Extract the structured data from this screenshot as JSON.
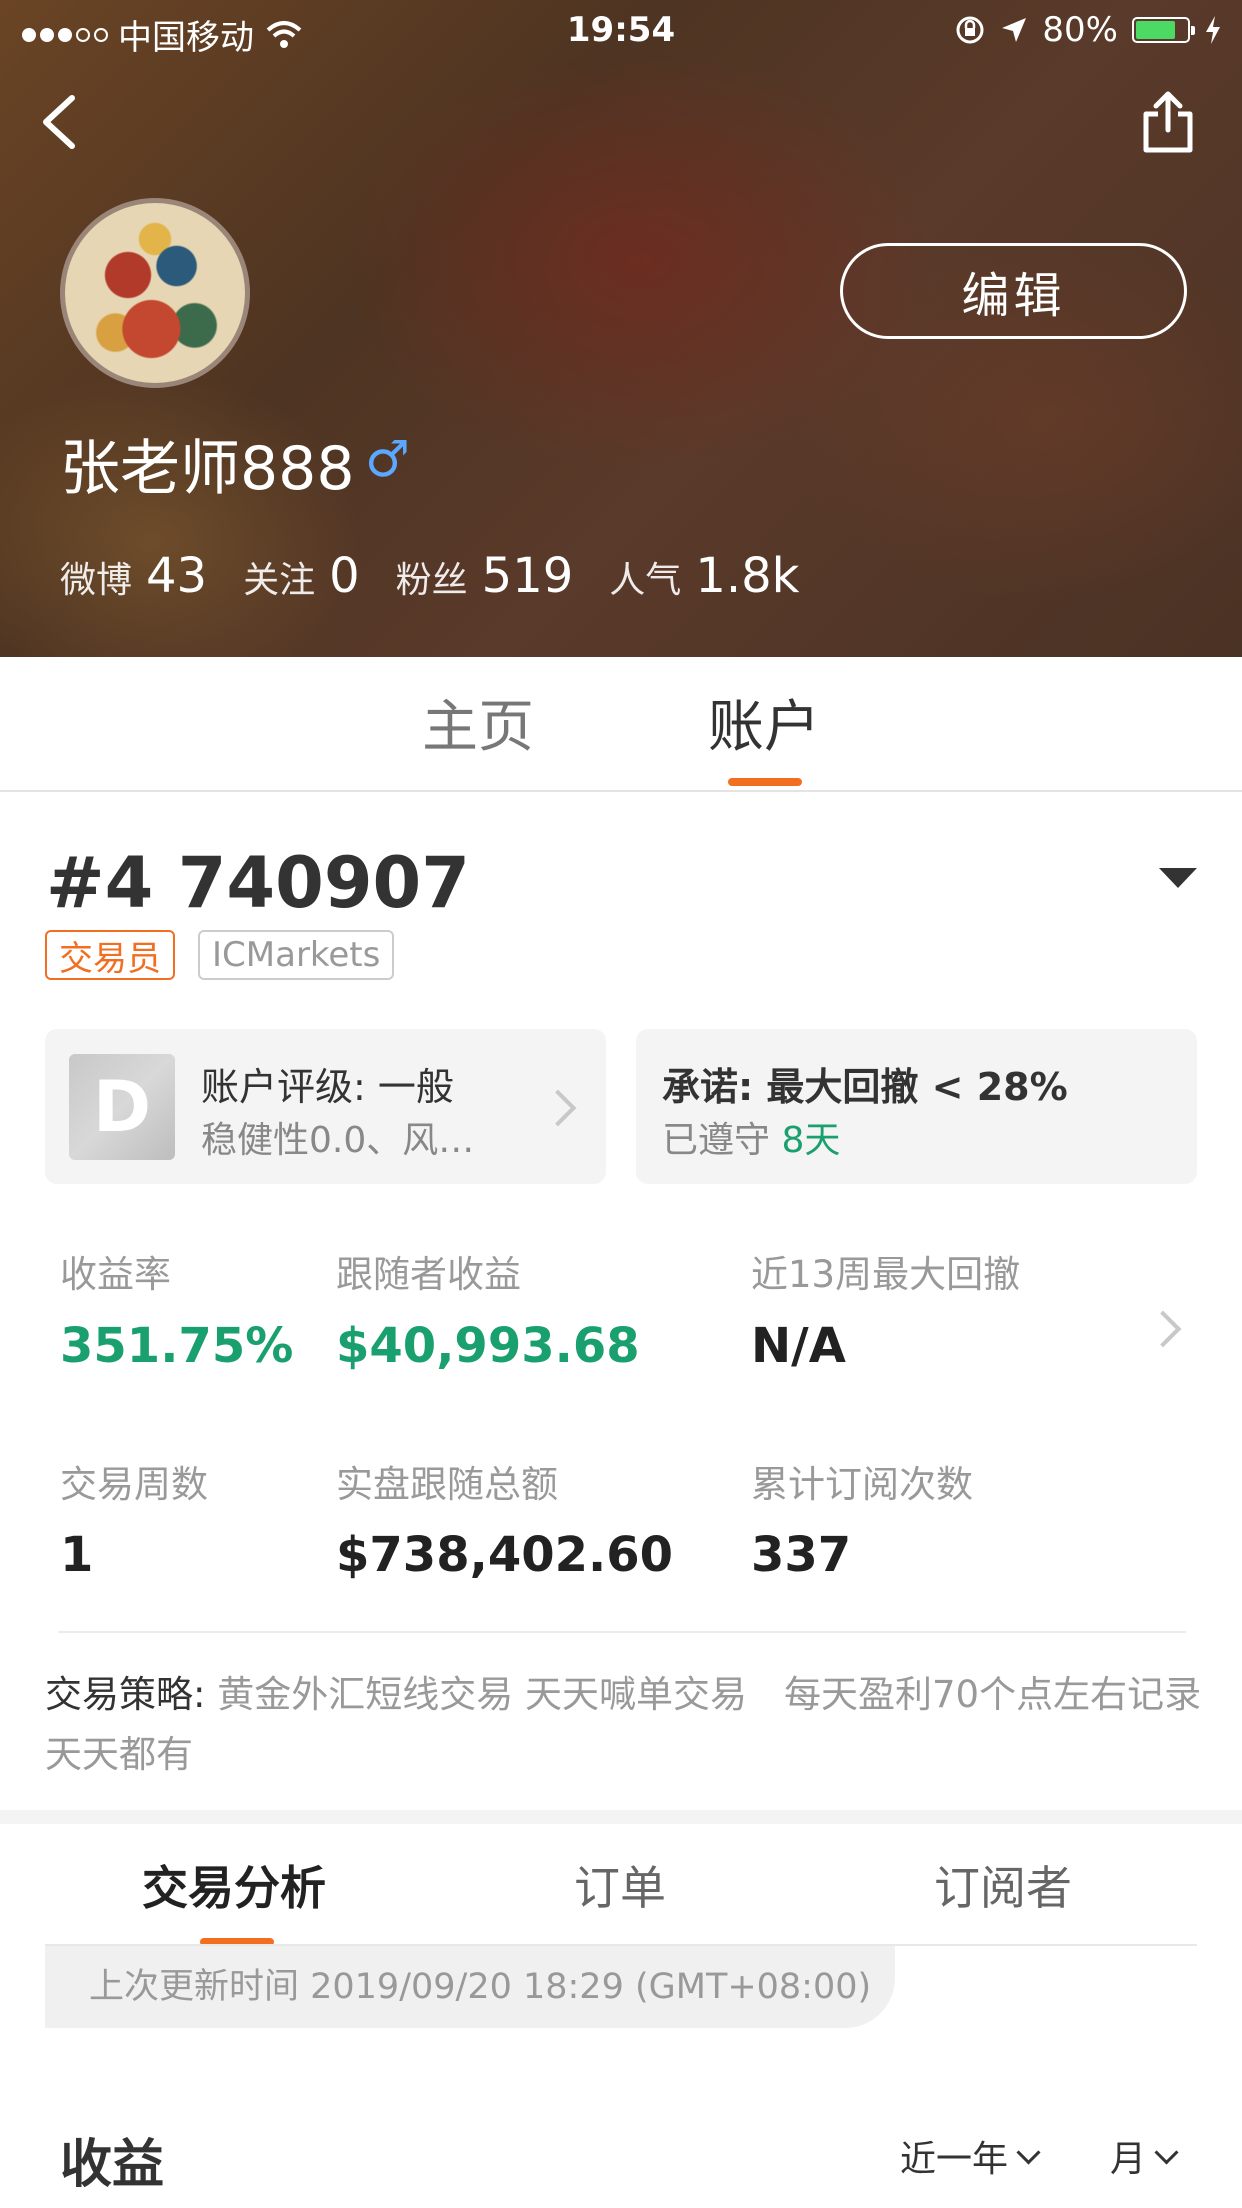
{
  "status_bar": {
    "carrier": "中国移动",
    "time": "19:54",
    "battery": "80%",
    "battery_level": 0.8
  },
  "profile": {
    "edit_label": "编辑",
    "name": "张老师888",
    "gender_symbol": "♂",
    "stats": [
      {
        "label": "微博",
        "value": "43"
      },
      {
        "label": "关注",
        "value": "0"
      },
      {
        "label": "粉丝",
        "value": "519"
      },
      {
        "label": "人气",
        "value": "1.8k"
      }
    ]
  },
  "tabs": [
    "主页",
    "账户"
  ],
  "account": {
    "id": "#4 740907",
    "role_tag": "交易员",
    "broker_tag": "ICMarkets",
    "rating": {
      "grade": "D",
      "title": "账户评级: 一般",
      "subtitle": "稳健性0.0、风…"
    },
    "promise": {
      "title": "承诺: 最大回撤 < 28%",
      "kept_label": "已遵守",
      "kept_value": "8天"
    },
    "metrics": [
      {
        "label": "收益率",
        "value": "351.75%"
      },
      {
        "label": "跟随者收益",
        "value": "$40,993.68"
      },
      {
        "label": "近13周最大回撤",
        "value": "N/A"
      },
      {
        "label": "交易周数",
        "value": "1"
      },
      {
        "label": "实盘跟随总额",
        "value": "$738,402.60"
      },
      {
        "label": "累计订阅次数",
        "value": "337"
      }
    ],
    "strategy_label": "交易策略:",
    "strategy_text": "黄金外汇短线交易 天天喊单交易　每天盈利70个点左右记录天天都有"
  },
  "analysis_tabs": [
    "交易分析",
    "订单",
    "订阅者"
  ],
  "last_update": "上次更新时间 2019/09/20 18:29 (GMT+08:00)",
  "earnings": {
    "title": "收益",
    "range": "近一年",
    "period": "月"
  },
  "colors": {
    "accent": "#f26f21",
    "positive": "#1aa06e",
    "gender": "#5aa8ff"
  }
}
